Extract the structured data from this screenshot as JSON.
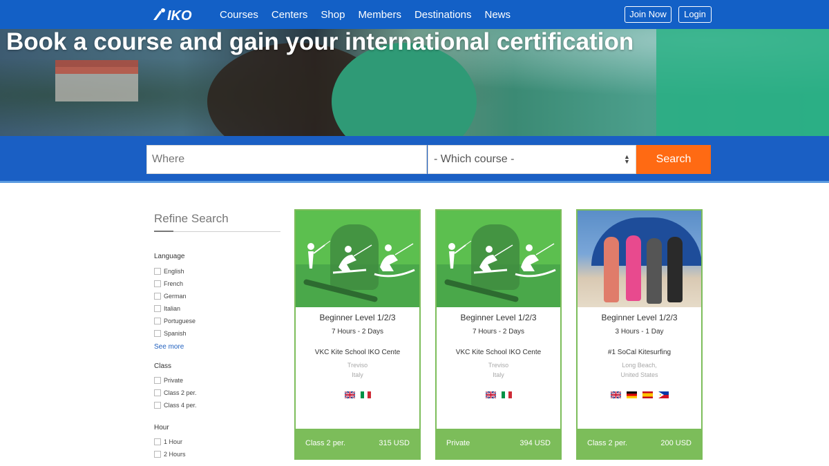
{
  "nav": {
    "logo_text": "IKO",
    "links": [
      "Courses",
      "Centers",
      "Shop",
      "Members",
      "Destinations",
      "News"
    ],
    "join_label": "Join Now",
    "login_label": "Login"
  },
  "hero": {
    "title": "Book a course and gain your international certification"
  },
  "search": {
    "where_placeholder": "Where",
    "course_select": "- Which course -",
    "search_label": "Search"
  },
  "sidebar": {
    "title": "Refine Search",
    "language": {
      "label": "Language",
      "options": [
        "English",
        "French",
        "German",
        "Italian",
        "Portuguese",
        "Spanish"
      ],
      "see_more": "See more"
    },
    "class": {
      "label": "Class",
      "options": [
        "Private",
        "Class 2 per.",
        "Class 4 per."
      ]
    },
    "hour": {
      "label": "Hour",
      "options": [
        "1 Hour",
        "2 Hours"
      ]
    }
  },
  "cards": [
    {
      "title": "Beginner Level 1/2/3",
      "duration": "7 Hours - 2 Days",
      "school": "VKC Kite School IKO Cente",
      "city": "Treviso",
      "country": "Italy",
      "flags": [
        "uk",
        "italy"
      ],
      "class": "Class 2 per.",
      "price": "315 USD"
    },
    {
      "title": "Beginner Level 1/2/3",
      "duration": "7 Hours - 2 Days",
      "school": "VKC Kite School IKO Cente",
      "city": "Treviso",
      "country": "Italy",
      "flags": [
        "uk",
        "italy"
      ],
      "class": "Private",
      "price": "394 USD"
    },
    {
      "title": "Beginner Level 1/2/3",
      "duration": "3 Hours - 1 Day",
      "school": "#1 SoCal Kitesurfing",
      "city": "Long Beach,",
      "country": "United States",
      "flags": [
        "uk",
        "germany",
        "spain",
        "philippines"
      ],
      "class": "Class 2 per.",
      "price": "200 USD"
    }
  ],
  "colors": {
    "nav_blue": "#1360c6",
    "search_orange": "#ff6a13",
    "card_green": "#7cbd5a"
  }
}
